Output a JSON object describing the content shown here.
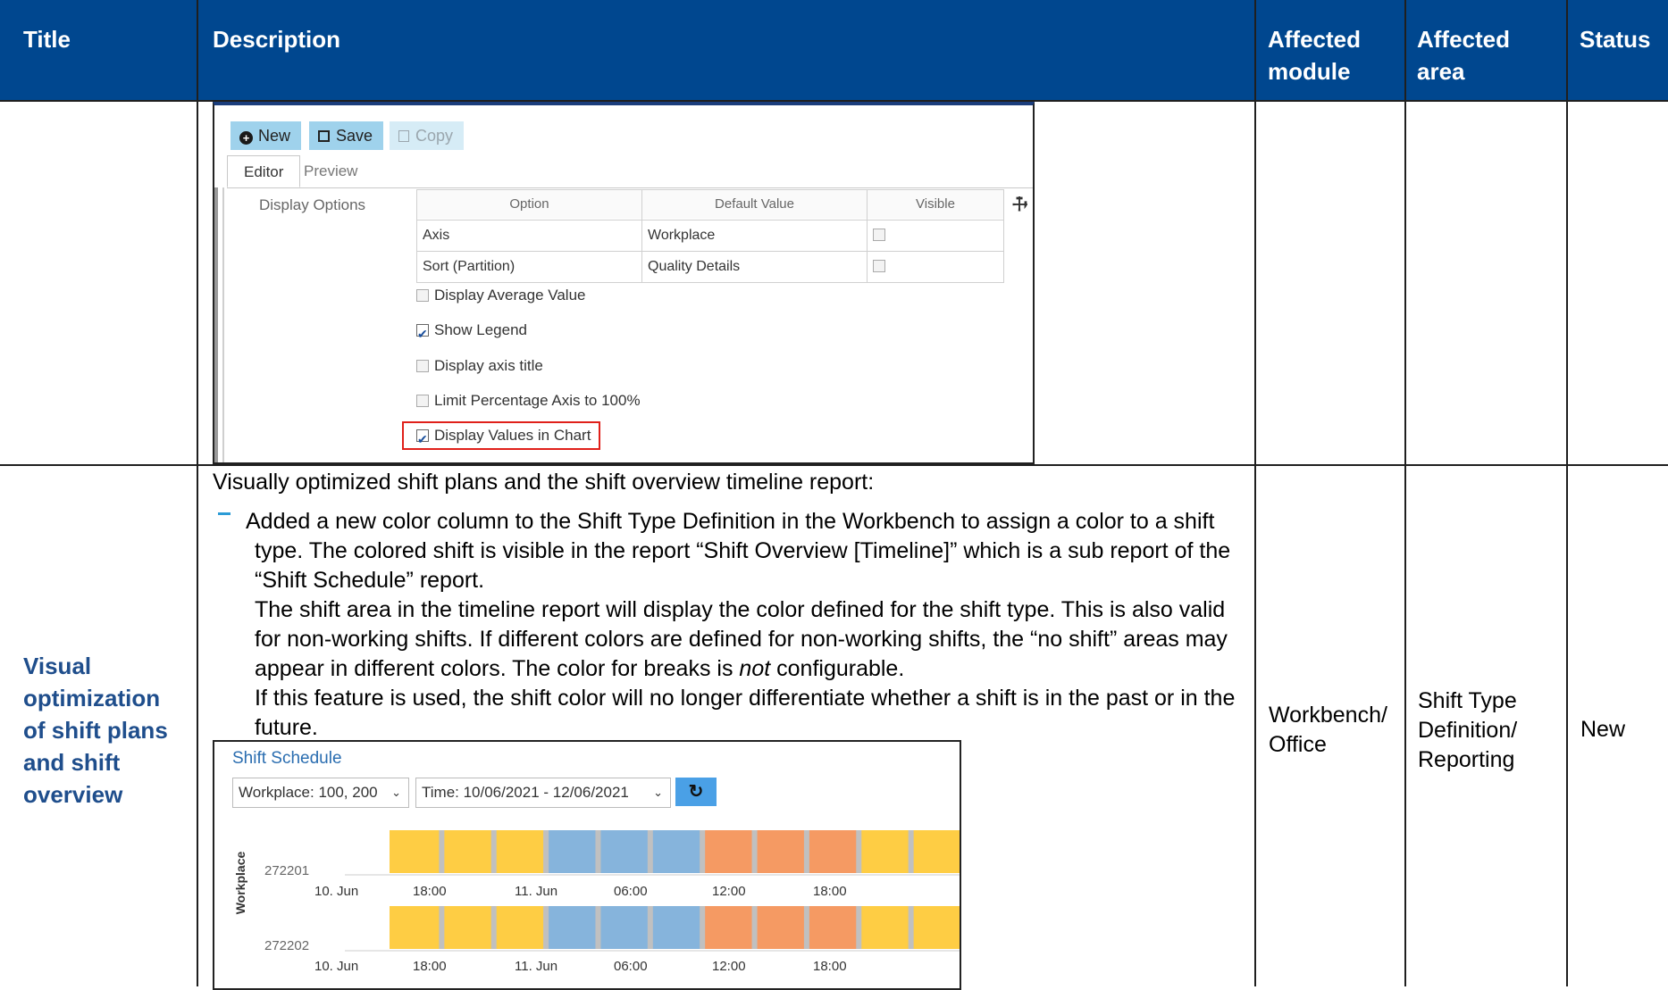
{
  "table": {
    "headers": {
      "title": "Title",
      "description": "Description",
      "module_line1": "Affected",
      "module_line2": "module",
      "area_line1": "Affected",
      "area_line2": "area",
      "status": "Status"
    },
    "colors": {
      "header_bg": "#00478f",
      "title_text": "#1f4e8c"
    }
  },
  "editor_shot": {
    "toolbar": {
      "new": "New",
      "save": "Save",
      "copy": "Copy"
    },
    "tabs": {
      "editor": "Editor",
      "preview": "Preview"
    },
    "section_label": "Display Options",
    "grid": {
      "headers": {
        "option": "Option",
        "default": "Default Value",
        "visible": "Visible"
      },
      "rows": [
        {
          "option": "Axis",
          "default": "Workplace"
        },
        {
          "option": "Sort (Partition)",
          "default": "Quality Details"
        }
      ]
    },
    "options": [
      {
        "label": "Display Average Value",
        "checked": false
      },
      {
        "label": "Show Legend",
        "checked": true
      },
      {
        "label": "Display axis title",
        "checked": false
      },
      {
        "label": "Limit Percentage Axis to 100%",
        "checked": false
      },
      {
        "label": "Display Values in Chart",
        "checked": true,
        "highlighted": true
      }
    ]
  },
  "row2": {
    "title_lines": [
      "Visual",
      "optimization",
      "of shift plans",
      "and shift",
      "overview"
    ],
    "intro": "Visually optimized shift plans and the shift overview timeline report:",
    "bullet_lines": [
      "Added a new color column to the Shift Type Definition in the Workbench to assign a color to a shift",
      "type. The colored shift is visible in the report “Shift Overview [Timeline]” which is a sub report of the",
      "“Shift Schedule” report.",
      "The shift area in the timeline report will display the color defined for the shift type. This is also valid",
      "for non-working shifts. If different colors are defined for non-working shifts, the “no shift” areas may"
    ],
    "line6_before": "appear in different colors. The color for breaks is ",
    "line6_em": "not",
    "line6_after": " configurable.",
    "bullet_lines_tail": [
      "If this feature is used, the shift color will no longer differentiate whether a shift is in the past or in the",
      "future."
    ],
    "module_lines": [
      "Workbench/",
      "Office"
    ],
    "area_lines": [
      "Shift Type",
      "Definition/",
      "Reporting"
    ],
    "status": "New"
  },
  "schedule_shot": {
    "title": "Shift Schedule",
    "workplace_select": "Workplace: 100, 200",
    "time_select": "Time: 10/06/2021 - 12/06/2021",
    "axis_title": "Workplace",
    "colors": {
      "yellow": "#fecd44",
      "blue": "#86b4dc",
      "orange": "#f59a63",
      "break": "#c0c0c0"
    },
    "chart_data": {
      "type": "timeline",
      "rows": [
        {
          "workplace": "272201",
          "segments": [
            "yellow",
            "yellow",
            "yellow",
            "blue",
            "blue",
            "blue",
            "orange",
            "orange",
            "orange",
            "yellow",
            "yellow"
          ]
        },
        {
          "workplace": "272202",
          "segments": [
            "yellow",
            "yellow",
            "yellow",
            "blue",
            "blue",
            "blue",
            "orange",
            "orange",
            "orange",
            "yellow",
            "yellow"
          ]
        }
      ],
      "x_ticks": [
        "10. Jun",
        "18:00",
        "11. Jun",
        "06:00",
        "12:00",
        "18:00"
      ]
    }
  }
}
